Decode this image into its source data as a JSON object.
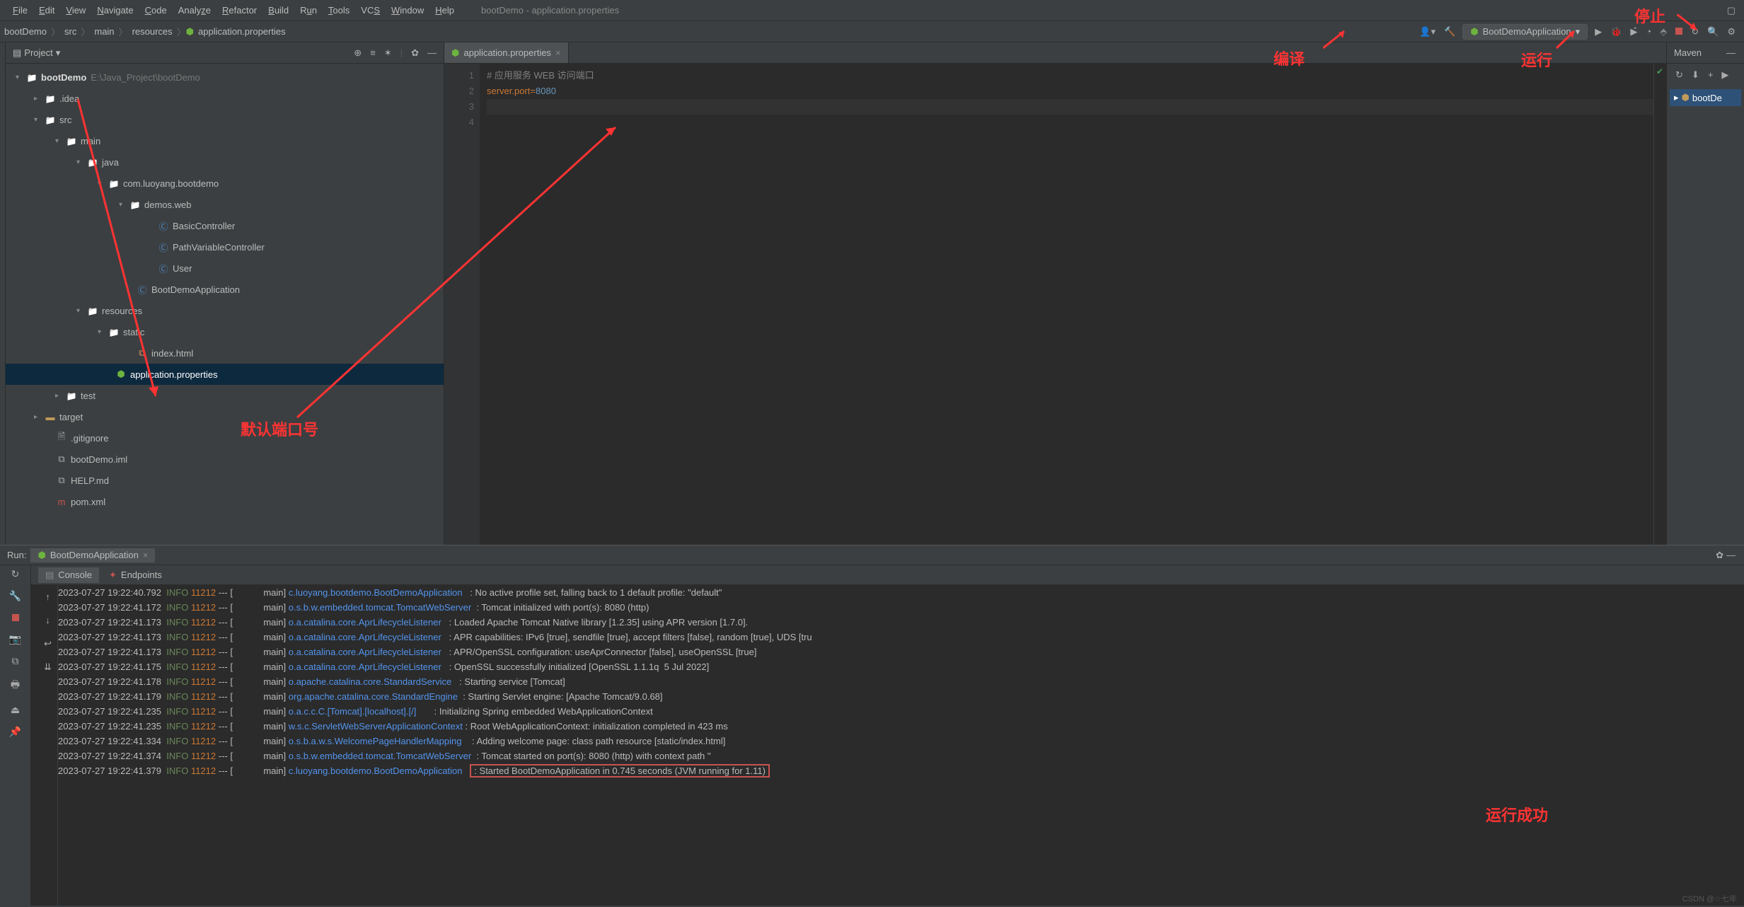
{
  "window_title": "bootDemo - application.properties",
  "menu": [
    "File",
    "Edit",
    "View",
    "Navigate",
    "Code",
    "Analyze",
    "Refactor",
    "Build",
    "Run",
    "Tools",
    "VCS",
    "Window",
    "Help"
  ],
  "breadcrumbs": [
    "bootDemo",
    "src",
    "main",
    "resources",
    "application.properties"
  ],
  "run_config": "BootDemoApplication",
  "project_panel_title": "Project",
  "project_root": "bootDemo",
  "project_root_path": "E:\\Java_Project\\bootDemo",
  "tree": {
    "idea": ".idea",
    "src": "src",
    "main": "main",
    "java": "java",
    "pkg": "com.luoyang.bootdemo",
    "demos": "demos.web",
    "c1": "BasicController",
    "c2": "PathVariableController",
    "c3": "User",
    "app": "BootDemoApplication",
    "resources": "resources",
    "static": "static",
    "index": "index.html",
    "appprops": "application.properties",
    "test": "test",
    "target": "target",
    "gitignore": ".gitignore",
    "iml": "bootDemo.iml",
    "help": "HELP.md",
    "pom": "pom.xml"
  },
  "editor_tab": "application.properties",
  "editor_lines": [
    "1",
    "2",
    "3",
    "4"
  ],
  "code": {
    "comment": "# 应用服务 WEB 访问端口",
    "key": "server.port",
    "eq": "=",
    "val": "8080"
  },
  "maven_title": "Maven",
  "maven_item": "bootDe",
  "run_title": "Run:",
  "run_tab": "BootDemoApplication",
  "console_tabs": {
    "console": "Console",
    "endpoints": "Endpoints"
  },
  "annotations": {
    "compile": "编译",
    "run": "运行",
    "stop": "停止",
    "default_port": "默认端口号",
    "run_success": "运行成功"
  },
  "log_lines": [
    {
      "ts": "2023-07-27 19:22:40.792",
      "lvl": "INFO",
      "pid": "11212",
      "thr": "main",
      "logger": "c.luoyang.bootdemo.BootDemoApplication",
      "msg": "No active profile set, falling back to 1 default profile: \"default\""
    },
    {
      "ts": "2023-07-27 19:22:41.172",
      "lvl": "INFO",
      "pid": "11212",
      "thr": "main",
      "logger": "o.s.b.w.embedded.tomcat.TomcatWebServer",
      "msg": "Tomcat initialized with port(s): 8080 (http)"
    },
    {
      "ts": "2023-07-27 19:22:41.173",
      "lvl": "INFO",
      "pid": "11212",
      "thr": "main",
      "logger": "o.a.catalina.core.AprLifecycleListener",
      "msg": "Loaded Apache Tomcat Native library [1.2.35] using APR version [1.7.0]."
    },
    {
      "ts": "2023-07-27 19:22:41.173",
      "lvl": "INFO",
      "pid": "11212",
      "thr": "main",
      "logger": "o.a.catalina.core.AprLifecycleListener",
      "msg": "APR capabilities: IPv6 [true], sendfile [true], accept filters [false], random [true], UDS [tru"
    },
    {
      "ts": "2023-07-27 19:22:41.173",
      "lvl": "INFO",
      "pid": "11212",
      "thr": "main",
      "logger": "o.a.catalina.core.AprLifecycleListener",
      "msg": "APR/OpenSSL configuration: useAprConnector [false], useOpenSSL [true]"
    },
    {
      "ts": "2023-07-27 19:22:41.175",
      "lvl": "INFO",
      "pid": "11212",
      "thr": "main",
      "logger": "o.a.catalina.core.AprLifecycleListener",
      "msg": "OpenSSL successfully initialized [OpenSSL 1.1.1q  5 Jul 2022]"
    },
    {
      "ts": "2023-07-27 19:22:41.178",
      "lvl": "INFO",
      "pid": "11212",
      "thr": "main",
      "logger": "o.apache.catalina.core.StandardService",
      "msg": "Starting service [Tomcat]"
    },
    {
      "ts": "2023-07-27 19:22:41.179",
      "lvl": "INFO",
      "pid": "11212",
      "thr": "main",
      "logger": "org.apache.catalina.core.StandardEngine",
      "msg": "Starting Servlet engine: [Apache Tomcat/9.0.68]"
    },
    {
      "ts": "2023-07-27 19:22:41.235",
      "lvl": "INFO",
      "pid": "11212",
      "thr": "main",
      "logger": "o.a.c.c.C.[Tomcat].[localhost].[/]",
      "msg": "Initializing Spring embedded WebApplicationContext"
    },
    {
      "ts": "2023-07-27 19:22:41.235",
      "lvl": "INFO",
      "pid": "11212",
      "thr": "main",
      "logger": "w.s.c.ServletWebServerApplicationContext",
      "msg": "Root WebApplicationContext: initialization completed in 423 ms"
    },
    {
      "ts": "2023-07-27 19:22:41.334",
      "lvl": "INFO",
      "pid": "11212",
      "thr": "main",
      "logger": "o.s.b.a.w.s.WelcomePageHandlerMapping",
      "msg": "Adding welcome page: class path resource [static/index.html]"
    },
    {
      "ts": "2023-07-27 19:22:41.374",
      "lvl": "INFO",
      "pid": "11212",
      "thr": "main",
      "logger": "o.s.b.w.embedded.tomcat.TomcatWebServer",
      "msg": "Tomcat started on port(s): 8080 (http) with context path ''"
    },
    {
      "ts": "2023-07-27 19:22:41.379",
      "lvl": "INFO",
      "pid": "11212",
      "thr": "main",
      "logger": "c.luoyang.bootdemo.BootDemoApplication",
      "msg": "Started BootDemoApplication in 0.745 seconds (JVM running for 1.11)",
      "boxed": true
    }
  ],
  "footer": "CSDN @☆七年"
}
